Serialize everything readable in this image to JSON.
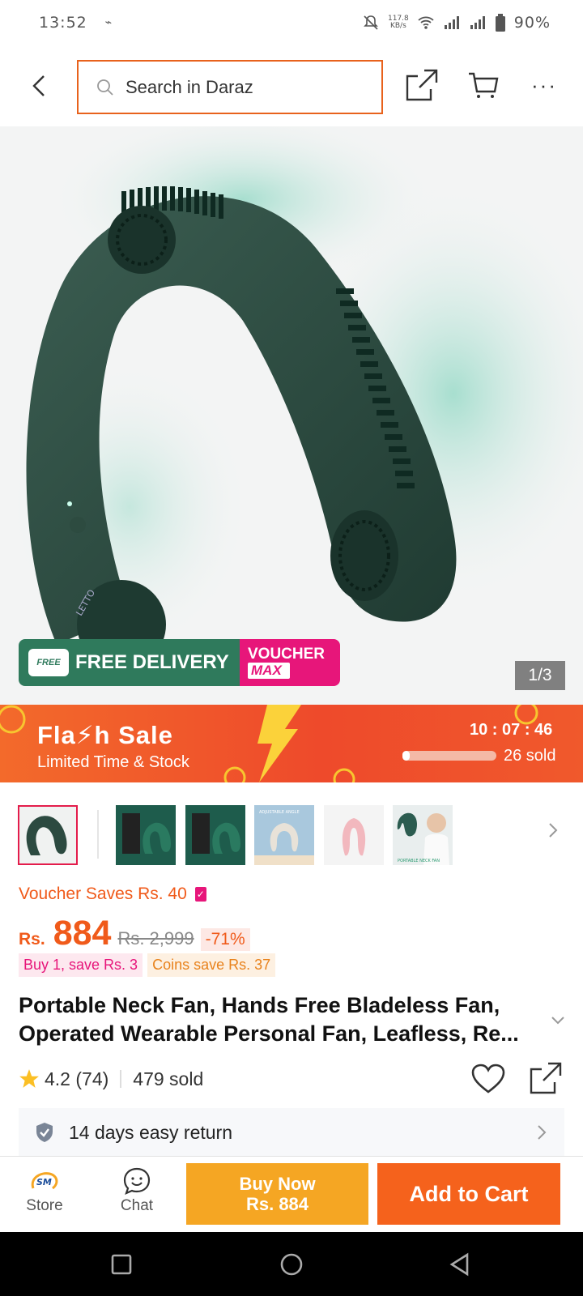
{
  "status": {
    "time": "13:52",
    "net_speed_value": "117.8",
    "net_speed_unit": "KB/s",
    "battery": "90%"
  },
  "header": {
    "search_placeholder": "Search in Daraz"
  },
  "hero": {
    "image_counter": "1/3",
    "free_delivery_badge": "FREE",
    "free_delivery_label": "FREE DELIVERY",
    "voucher_max_line1": "VOUCHER",
    "voucher_max_line2": "MAX",
    "product_engraving": "LETTO"
  },
  "flash_sale": {
    "title": "Fla⚡h Sale",
    "subtitle": "Limited Time & Stock",
    "timer": "10 : 07 : 46",
    "progress": 0.08,
    "sold_text": "26 sold"
  },
  "thumbnails": [
    {
      "alt": "neck fan green"
    },
    {
      "alt": "neck fan with box"
    },
    {
      "alt": "neck fan with box"
    },
    {
      "alt": "adjustable angle"
    },
    {
      "alt": "neck fan pink"
    },
    {
      "alt": "portable neck fan model"
    }
  ],
  "thumb_texts": {
    "t4": "ADJUSTABLE ANGLE",
    "t6": "PORTABLE NECK FAN"
  },
  "pricing": {
    "voucher_text": "Voucher Saves Rs. 40",
    "currency": "Rs.",
    "price": "884",
    "original_price": "Rs. 2,999",
    "discount": "-71%",
    "promo_buy": "Buy 1, save Rs. 3",
    "promo_coins": "Coins save Rs. 37"
  },
  "product": {
    "title": "Portable Neck Fan, Hands Free Bladeless Fan, Operated Wearable Personal Fan, Leafless, Re...",
    "rating": "4.2",
    "reviews": "(74)",
    "sold": "479 sold",
    "return_policy": "14 days easy return"
  },
  "bottom_bar": {
    "store_label": "Store",
    "chat_label": "Chat",
    "buy_now_line1": "Buy Now",
    "buy_now_line2": "Rs. 884",
    "add_to_cart": "Add to Cart",
    "store_logo_text": "SM"
  },
  "colors": {
    "accent_orange": "#f5621c",
    "buy_now": "#f5a623",
    "flash_red": "#ee4a2b",
    "voucher_pink": "#e7167a",
    "delivery_green": "#2f7a5c"
  }
}
